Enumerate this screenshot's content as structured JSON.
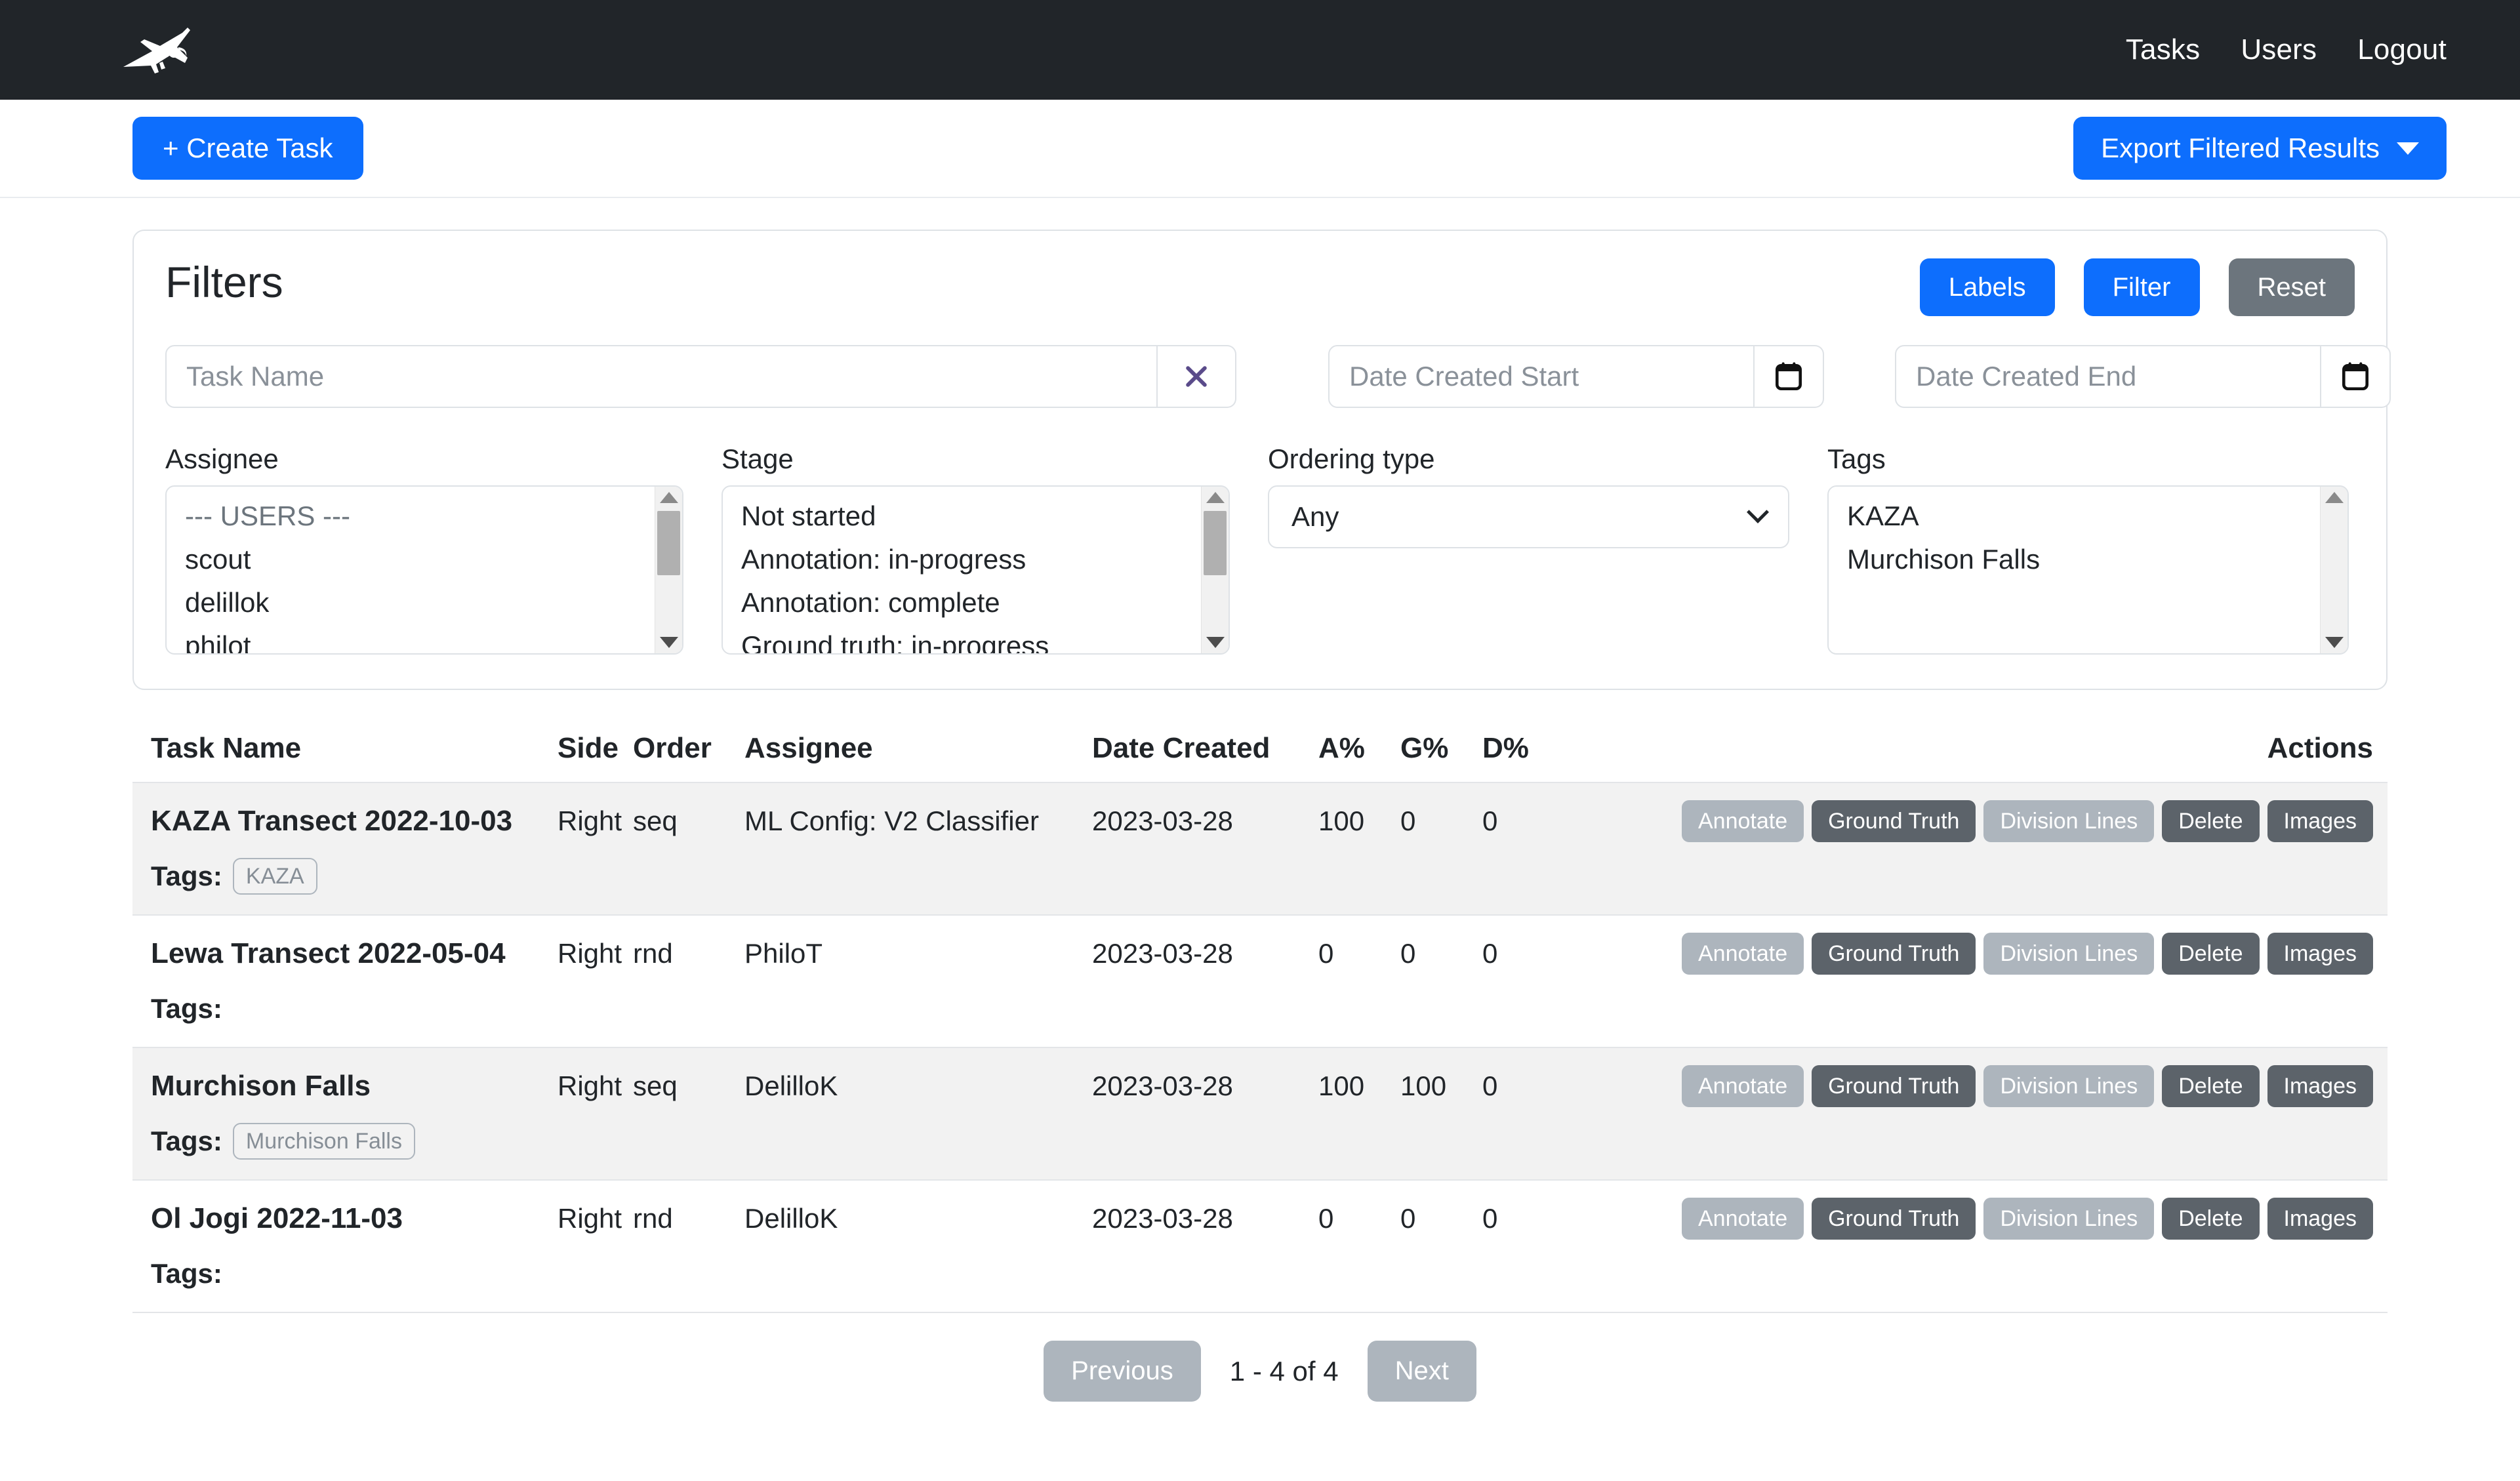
{
  "navbar": {
    "logo_icon": "airplane-icon",
    "links": [
      {
        "label": "Tasks"
      },
      {
        "label": "Users"
      },
      {
        "label": "Logout"
      }
    ]
  },
  "toolbar": {
    "create_label": "+ Create Task",
    "export_label": "Export Filtered Results"
  },
  "filters": {
    "title": "Filters",
    "labels_button": "Labels",
    "filter_button": "Filter",
    "reset_button": "Reset",
    "task_name_placeholder": "Task Name",
    "task_name_value": "",
    "clear_icon": "close-icon",
    "date_start_placeholder": "Date Created Start",
    "date_start_value": "",
    "date_end_placeholder": "Date Created End",
    "date_end_value": "",
    "calendar_icon": "calendar-icon",
    "assignee": {
      "label": "Assignee",
      "options": [
        "--- USERS ---",
        "scout",
        "delillok",
        "philot"
      ]
    },
    "stage": {
      "label": "Stage",
      "options": [
        "Not started",
        "Annotation: in-progress",
        "Annotation: complete",
        "Ground truth: in-progress"
      ]
    },
    "ordering": {
      "label": "Ordering type",
      "selected": "Any"
    },
    "tags": {
      "label": "Tags",
      "options": [
        "KAZA",
        "Murchison Falls"
      ]
    }
  },
  "table": {
    "headers": {
      "name": "Task Name",
      "side": "Side",
      "order": "Order",
      "assignee": "Assignee",
      "date": "Date Created",
      "a": "A%",
      "g": "G%",
      "d": "D%",
      "actions": "Actions"
    },
    "tags_label": "Tags:",
    "action_labels": {
      "annotate": "Annotate",
      "ground_truth": "Ground Truth",
      "division_lines": "Division Lines",
      "delete": "Delete",
      "images": "Images"
    },
    "rows": [
      {
        "name": "KAZA Transect 2022-10-03",
        "side": "Right",
        "order": "seq",
        "assignee": "ML Config: V2 Classifier",
        "date": "2023-03-28",
        "a": "100",
        "g": "0",
        "d": "0",
        "tag": "KAZA"
      },
      {
        "name": "Lewa Transect 2022-05-04",
        "side": "Right",
        "order": "rnd",
        "assignee": "PhiloT",
        "date": "2023-03-28",
        "a": "0",
        "g": "0",
        "d": "0",
        "tag": ""
      },
      {
        "name": "Murchison Falls",
        "side": "Right",
        "order": "seq",
        "assignee": "DelilloK",
        "date": "2023-03-28",
        "a": "100",
        "g": "100",
        "d": "0",
        "tag": "Murchison Falls"
      },
      {
        "name": "Ol Jogi 2022-11-03",
        "side": "Right",
        "order": "rnd",
        "assignee": "DelilloK",
        "date": "2023-03-28",
        "a": "0",
        "g": "0",
        "d": "0",
        "tag": ""
      }
    ]
  },
  "pagination": {
    "previous": "Previous",
    "info": "1 - 4 of 4",
    "next": "Next"
  },
  "colors": {
    "navbar_bg": "#212529",
    "primary": "#0d6efd",
    "secondary": "#6c757d",
    "action_light": "#adb5bd",
    "action_dark": "#5c636a",
    "clear_icon": "#5a4b8a"
  }
}
